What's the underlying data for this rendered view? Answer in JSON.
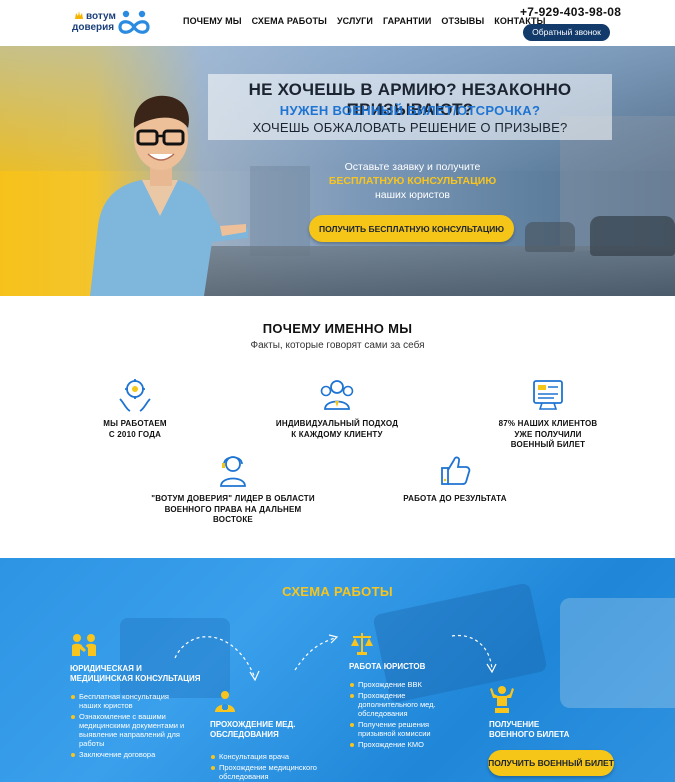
{
  "header": {
    "logo": {
      "line1": "вотум",
      "line2": "доверия"
    },
    "nav": [
      "ПОЧЕМУ МЫ",
      "СХЕМА РАБОТЫ",
      "УСЛУГИ",
      "ГАРАНТИИ",
      "ОТЗЫВЫ",
      "КОНТАКТЫ"
    ],
    "phone": "+7-929-403-98-08",
    "callback_label": "Обратный звонок"
  },
  "hero": {
    "headline": "НЕ ХОЧЕШЬ В АРМИЮ? НЕЗАКОННО ПРИЗЫВАЮТ?",
    "subheadline": "НУЖЕН ВОЕННЫЙ БИЛЕТ/ОТСРОЧКА?",
    "line3": "ХОЧЕШЬ ОБЖАЛОВАТЬ РЕШЕНИЕ О ПРИЗЫВЕ?",
    "lead_1": "Оставьте заявку и получите",
    "lead_highlight": "БЕСПЛАТНУЮ КОНСУЛЬТАЦИЮ",
    "lead_2": "наших юристов",
    "cta_label": "ПОЛУЧИТЬ БЕСПЛАТНУЮ КОНСУЛЬТАЦИЮ"
  },
  "why": {
    "title": "ПОЧЕМУ ИМЕННО МЫ",
    "subtitle": "Факты, которые говорят сами за себя",
    "features": [
      {
        "icon": "gear-hands-icon",
        "lines": [
          "МЫ РАБОТАЕМ",
          "С 2010 ГОДА"
        ]
      },
      {
        "icon": "team-icon",
        "lines": [
          "ИНДИВИДУАЛЬНЫЙ ПОДХОД",
          "К КАЖДОМУ КЛИЕНТУ"
        ]
      },
      {
        "icon": "document-screen-icon",
        "lines": [
          "87% НАШИХ КЛИЕНТОВ",
          "УЖЕ ПОЛУЧИЛИ",
          "ВОЕННЫЙ БИЛЕТ"
        ]
      },
      {
        "icon": "support-agent-icon",
        "lines": [
          "\"ВОТУМ ДОВЕРИЯ\" ЛИДЕР В ОБЛАСТИ",
          "ВОЕННОГО ПРАВА НА ДАЛЬНЕМ",
          "ВОСТОКЕ"
        ]
      },
      {
        "icon": "thumbs-up-icon",
        "lines": [
          "РАБОТА ДО РЕЗУЛЬТАТА"
        ]
      }
    ]
  },
  "scheme": {
    "title": "СХЕМА РАБОТЫ",
    "steps": [
      {
        "title_lines": [
          "ЮРИДИЧЕСКАЯ И",
          "МЕДИЦИНСКАЯ КОНСУЛЬТАЦИЯ"
        ],
        "items": [
          "Бесплатная консультация наших юристов",
          "Ознакомление с вашими медицинскими документами и выявление направлений для работы",
          "Заключение договора"
        ]
      },
      {
        "title_lines": [
          "ПРОХОЖДЕНИЕ МЕД.",
          "ОБСЛЕДОВАНИЯ"
        ],
        "items": [
          "Консультация врача",
          "Прохождение медицинского обследования"
        ]
      },
      {
        "title_lines": [
          "РАБОТА ЮРИСТОВ"
        ],
        "items": [
          "Прохождение ВВК",
          "Прохождение дополнительного мед. обследования",
          "Получение решения призывной комиссии",
          "Прохождение КМО"
        ]
      },
      {
        "title_lines": [
          "ПОЛУЧЕНИЕ",
          "ВОЕННОГО БИЛЕТА"
        ],
        "items": []
      }
    ],
    "cta_label": "ПОЛУЧИТЬ ВОЕННЫЙ БИЛЕТ"
  },
  "colors": {
    "accent": "#f5c518",
    "primary": "#1e74d2",
    "dark": "#123a6b"
  }
}
